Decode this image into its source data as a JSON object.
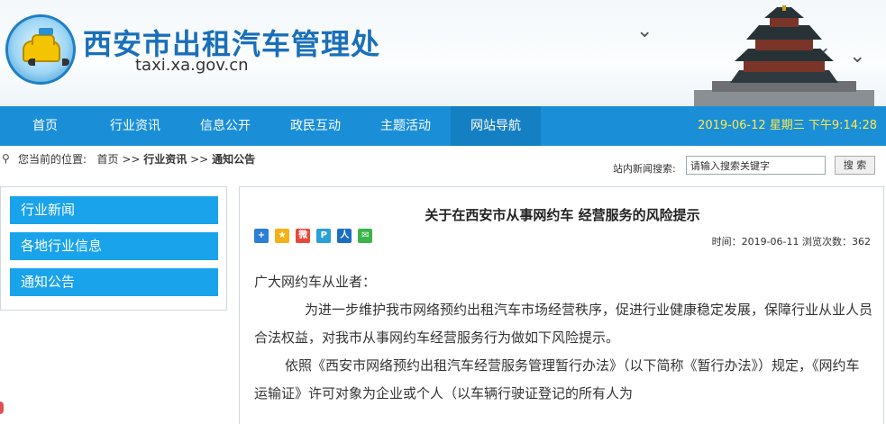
{
  "header": {
    "title": "西安市出租汽车管理处",
    "domain": "taxi.xa.gov.cn",
    "logo_icon": "taxi-logo-icon"
  },
  "nav": {
    "items": [
      {
        "label": "首页"
      },
      {
        "label": "行业资讯"
      },
      {
        "label": "信息公开"
      },
      {
        "label": "政民互动"
      },
      {
        "label": "主题活动"
      },
      {
        "label": "网站导航"
      }
    ],
    "active_index": 5,
    "datetime": "2019-06-12 星期三 下午9:14:28",
    "bg_color": "#1a8fd8",
    "date_color": "#ffe84d"
  },
  "breadcrumb": {
    "prefix": "您当前的位置:",
    "home": "首页",
    "sep": ">>",
    "level1": "行业资讯",
    "level2": "通知公告"
  },
  "search": {
    "label": "站内新闻搜索:",
    "placeholder": "请输入搜索关键字",
    "button": "搜 索"
  },
  "sidebar": {
    "items": [
      {
        "label": "行业新闻"
      },
      {
        "label": "各地行业信息"
      },
      {
        "label": "通知公告"
      }
    ],
    "item_color": "#19a3ea"
  },
  "article": {
    "title": "关于在西安市从事网约车 经营服务的风险提示",
    "meta": "时间：2019-06-11 浏览次数：362",
    "share_icons": [
      "qzone-share-icon",
      "favorite-share-icon",
      "weibo-share-icon",
      "pengyou-share-icon",
      "renren-share-icon",
      "wechat-share-icon"
    ],
    "greeting": "广大网约车从业者：",
    "paragraph1": "为进一步维护我市网络预约出租汽车市场经营秩序，促进行业健康稳定发展，保障行业从业人员合法权益，对我市从事网约车经营服务行为做如下风险提示。",
    "paragraph2": "依照《西安市网络预约出租汽车经营服务管理暂行办法》（以下简称《暂行办法》）规定，《网约车运输证》许可对象为企业或个人（以车辆行驶证登记的所有人为"
  }
}
